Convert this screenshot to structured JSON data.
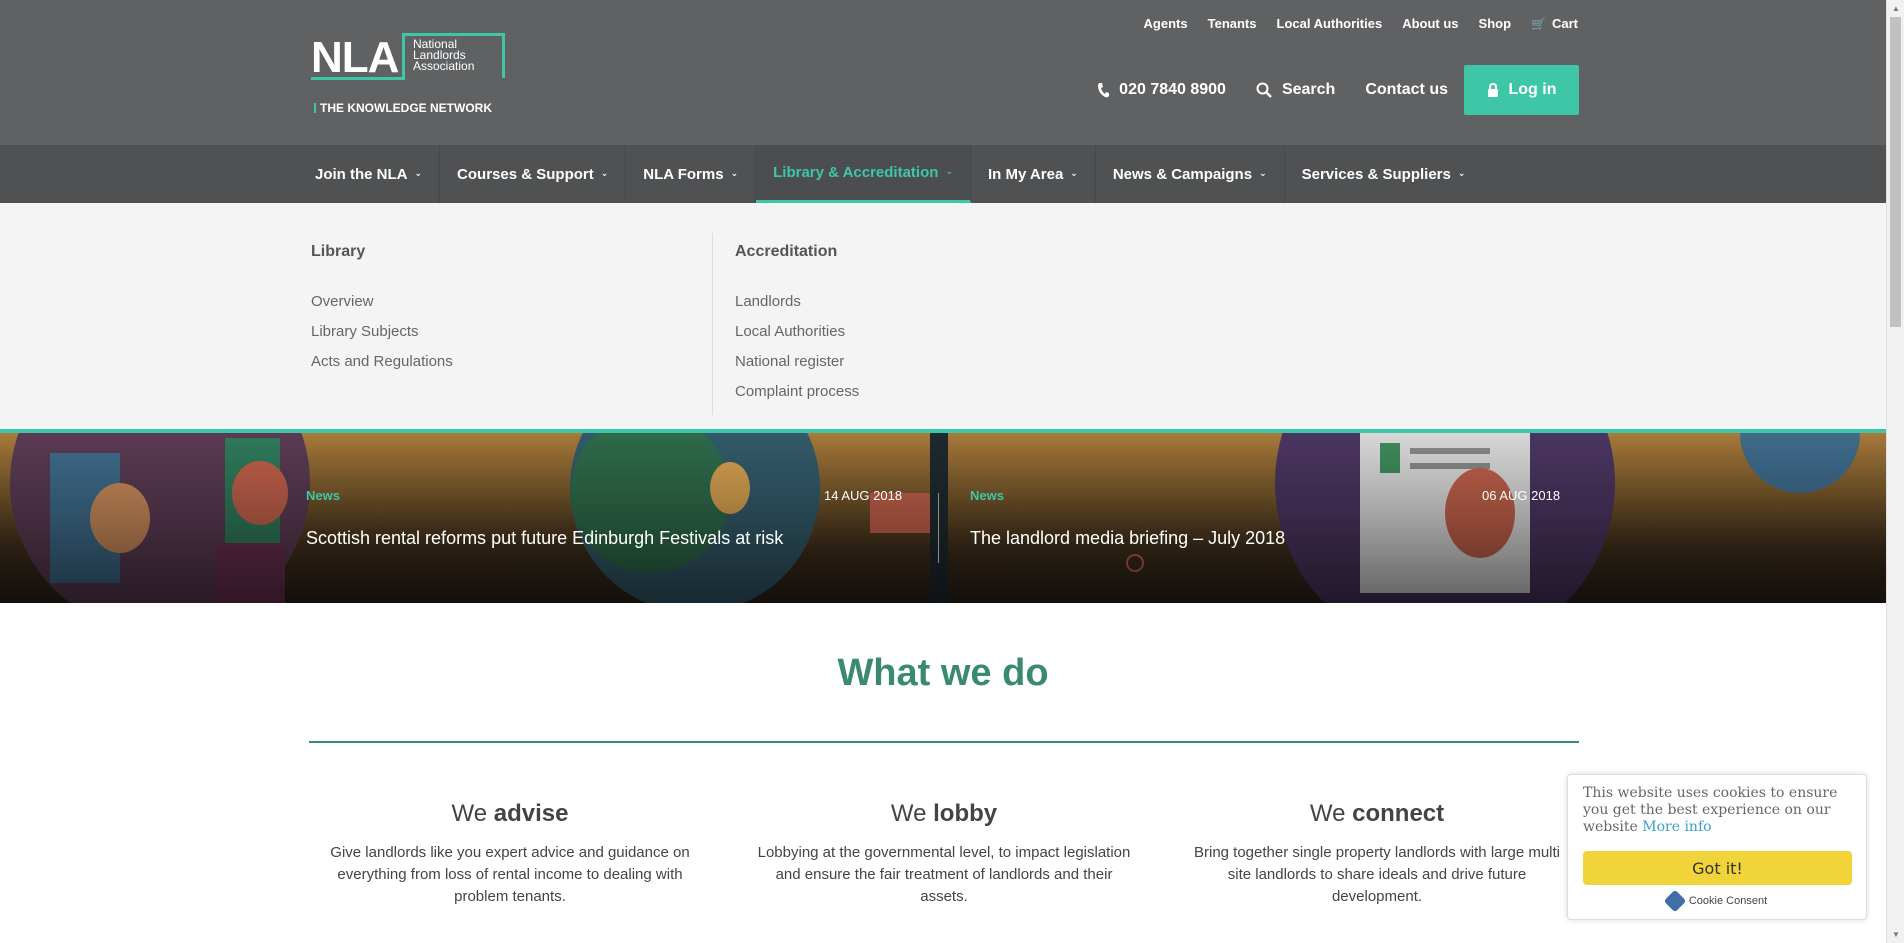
{
  "colors": {
    "accent": "#3fc6a6",
    "header_bg": "#5f6163",
    "nav_bg": "#4f5153",
    "heading_green": "#3a8a70",
    "cookie_button": "#f1d33a"
  },
  "logo": {
    "mark": "NLA",
    "name_lines": [
      "National",
      "Landlords",
      "Association"
    ],
    "tagline": "THE KNOWLEDGE NETWORK"
  },
  "top_links": [
    "Agents",
    "Tenants",
    "Local Authorities",
    "About us",
    "Shop",
    "Cart"
  ],
  "contact": {
    "phone": "020 7840 8900",
    "search": "Search",
    "contact_us": "Contact us",
    "login": "Log in"
  },
  "nav": [
    {
      "label": "Join the NLA",
      "active": false
    },
    {
      "label": "Courses & Support",
      "active": false
    },
    {
      "label": "NLA Forms",
      "active": false
    },
    {
      "label": "Library & Accreditation",
      "active": true
    },
    {
      "label": "In My Area",
      "active": false
    },
    {
      "label": "News & Campaigns",
      "active": false
    },
    {
      "label": "Services & Suppliers",
      "active": false
    }
  ],
  "dropdown": {
    "library": {
      "heading": "Library",
      "links": [
        "Overview",
        "Library Subjects",
        "Acts and Regulations"
      ]
    },
    "accreditation": {
      "heading": "Accreditation",
      "links": [
        "Landlords",
        "Local Authorities",
        "National register",
        "Complaint process"
      ]
    }
  },
  "news": [
    {
      "tag": "News",
      "date": "14 AUG 2018",
      "title": "Scottish rental reforms put future Edinburgh Festivals at risk"
    },
    {
      "tag": "News",
      "date": "06 AUG 2018",
      "title": "The landlord media briefing – July 2018"
    }
  ],
  "what_we_do": {
    "title": "What we do",
    "columns": [
      {
        "prefix": "We",
        "verb": "advise",
        "text": "Give landlords like you expert advice and guidance on everything from loss of rental income to dealing with problem tenants."
      },
      {
        "prefix": "We",
        "verb": "lobby",
        "text": "Lobbying at the governmental level, to impact legislation and ensure the fair treatment of landlords and their assets."
      },
      {
        "prefix": "We",
        "verb": "connect",
        "text": "Bring together single property landlords with large multi site landlords to share ideals and drive future development."
      }
    ]
  },
  "cookie": {
    "message": "This website uses cookies to ensure you get the best experience on our website",
    "more_info": "More info",
    "button": "Got it!",
    "brand": "Cookie Consent"
  }
}
